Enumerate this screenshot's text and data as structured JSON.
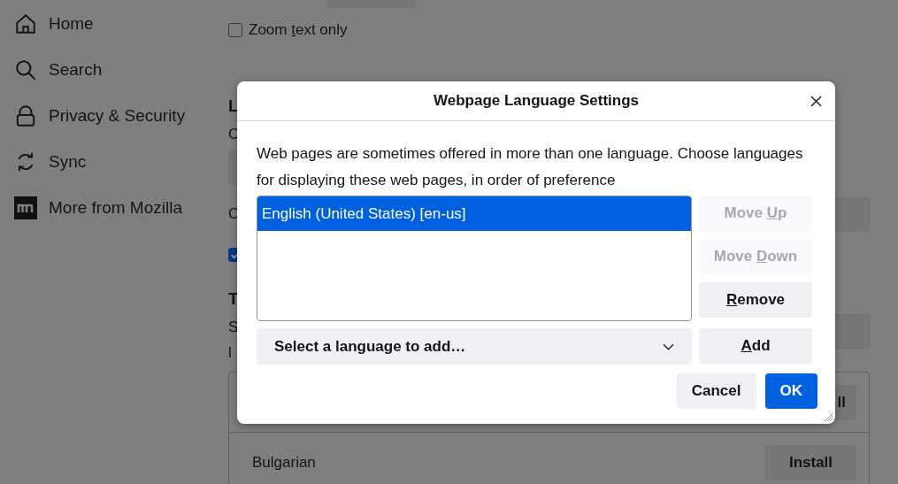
{
  "sidebar": {
    "items": [
      {
        "label": "Home",
        "kind": "home"
      },
      {
        "label": "Search",
        "kind": "search"
      },
      {
        "label": "Privacy & Security",
        "kind": "lock"
      },
      {
        "label": "Sync",
        "kind": "sync"
      },
      {
        "label": "More from Mozilla",
        "kind": "mozilla"
      }
    ]
  },
  "zoom_text_only": {
    "label_parts": [
      "Zoom ",
      "t",
      "ext only"
    ],
    "checked": false
  },
  "language_section": {
    "heading": "L",
    "line_1": "C",
    "line_2": "C",
    "checkbox_checked": true
  },
  "translations_section": {
    "heading": "T",
    "line_1": "S",
    "line_2": "l",
    "rows": [
      {
        "button": "ll"
      },
      {
        "name": "Bulgarian",
        "button": "Install"
      }
    ]
  },
  "dialog": {
    "title": "Webpage Language Settings",
    "description": "Web pages are sometimes offered in more than one language. Choose languages for displaying these web pages, in order of preference",
    "languages": [
      {
        "label": "English (United States) [en-us]",
        "selected": true
      }
    ],
    "side_buttons": [
      {
        "pre": "Move ",
        "key": "U",
        "post": "p",
        "disabled": true
      },
      {
        "pre": "Move ",
        "key": "D",
        "post": "own",
        "disabled": true
      },
      {
        "key": "R",
        "post": "emove",
        "disabled": false
      }
    ],
    "select": {
      "value": "Select a language to add…"
    },
    "add_button": {
      "key": "A",
      "post": "dd",
      "disabled": false
    },
    "cancel": "Cancel",
    "ok": "OK"
  }
}
